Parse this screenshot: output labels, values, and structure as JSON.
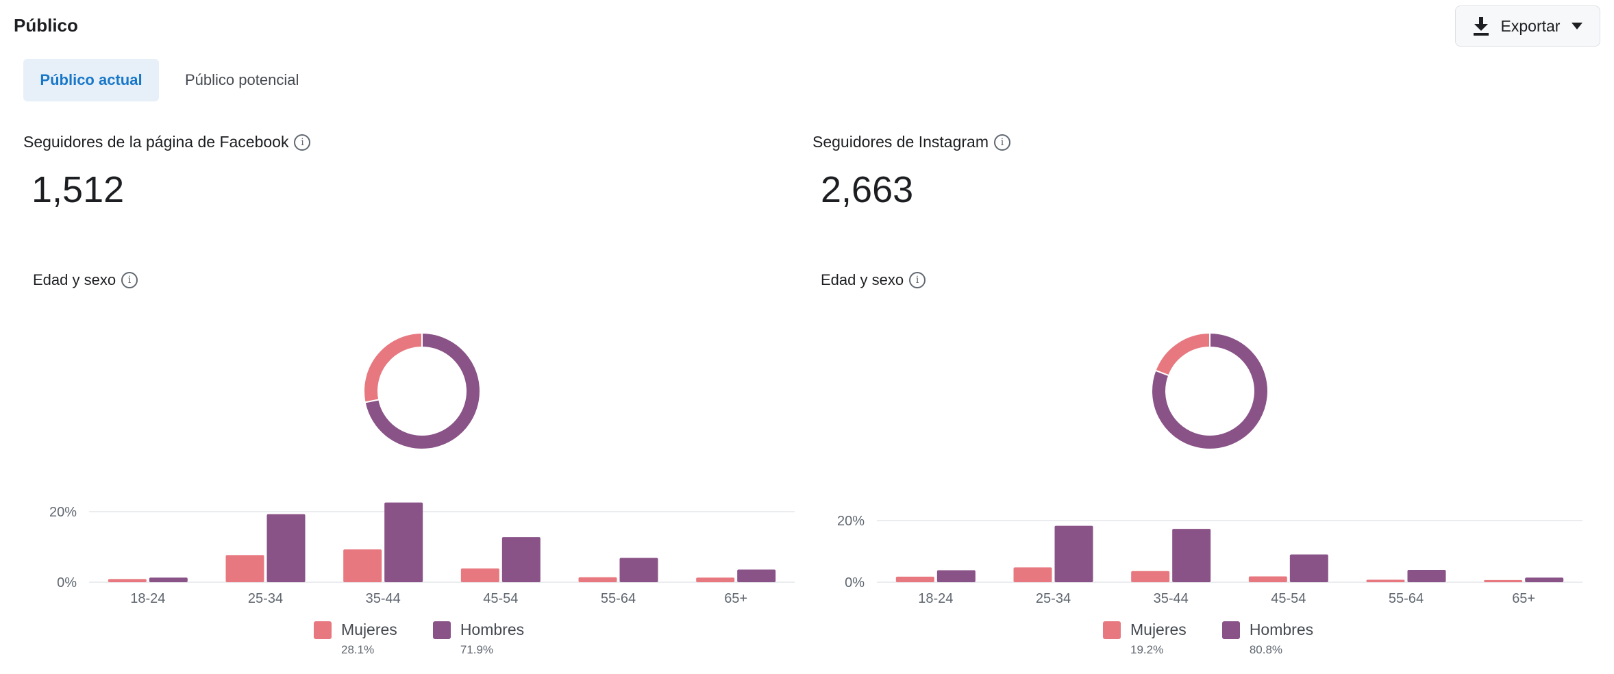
{
  "header": {
    "title": "Público",
    "export_label": "Exportar",
    "export_icon": "download-icon",
    "dropdown_icon": "caret-down-icon"
  },
  "tabs": [
    {
      "label": "Público actual",
      "active": true
    },
    {
      "label": "Público potencial",
      "active": false
    }
  ],
  "colors": {
    "mujeres": "#e8787f",
    "hombres": "#8a5387",
    "tab_active_bg": "#e7f0f8",
    "tab_active_text": "#1877c9"
  },
  "panels": [
    {
      "metric_label": "Seguidores de la página de Facebook",
      "metric_value": "1,512",
      "section_label": "Edad y sexo",
      "legend": [
        {
          "name": "Mujeres",
          "pct": "28.1%"
        },
        {
          "name": "Hombres",
          "pct": "71.9%"
        }
      ]
    },
    {
      "metric_label": "Seguidores de Instagram",
      "metric_value": "2,663",
      "section_label": "Edad y sexo",
      "legend": [
        {
          "name": "Mujeres",
          "pct": "19.2%"
        },
        {
          "name": "Hombres",
          "pct": "80.8%"
        }
      ]
    }
  ],
  "chart_data": [
    {
      "type": "bar",
      "title": "",
      "categories": [
        "18-24",
        "25-34",
        "35-44",
        "45-54",
        "55-64",
        "65+"
      ],
      "series": [
        {
          "name": "Mujeres",
          "values": [
            0.9,
            7.7,
            9.3,
            3.9,
            1.4,
            1.3
          ]
        },
        {
          "name": "Hombres",
          "values": [
            1.3,
            19.3,
            22.6,
            12.8,
            6.9,
            3.6
          ]
        }
      ],
      "ylim": [
        0,
        20
      ],
      "yticks": [
        "0%",
        "20%"
      ],
      "donut": {
        "values": [
          28.1,
          71.9
        ],
        "labels": [
          "Mujeres",
          "Hombres"
        ]
      },
      "grid": true,
      "legend_placement": "bottom"
    },
    {
      "type": "bar",
      "title": "",
      "categories": [
        "18-24",
        "25-34",
        "35-44",
        "45-54",
        "55-64",
        "65+"
      ],
      "series": [
        {
          "name": "Mujeres",
          "values": [
            1.8,
            4.8,
            3.6,
            1.9,
            0.8,
            0.7
          ]
        },
        {
          "name": "Hombres",
          "values": [
            3.9,
            18.3,
            17.3,
            9.0,
            4.0,
            1.5
          ]
        }
      ],
      "ylim": [
        0,
        20
      ],
      "yticks": [
        "0%",
        "20%"
      ],
      "donut": {
        "values": [
          19.2,
          80.8
        ],
        "labels": [
          "Mujeres",
          "Hombres"
        ]
      },
      "grid": true,
      "legend_placement": "bottom"
    }
  ]
}
